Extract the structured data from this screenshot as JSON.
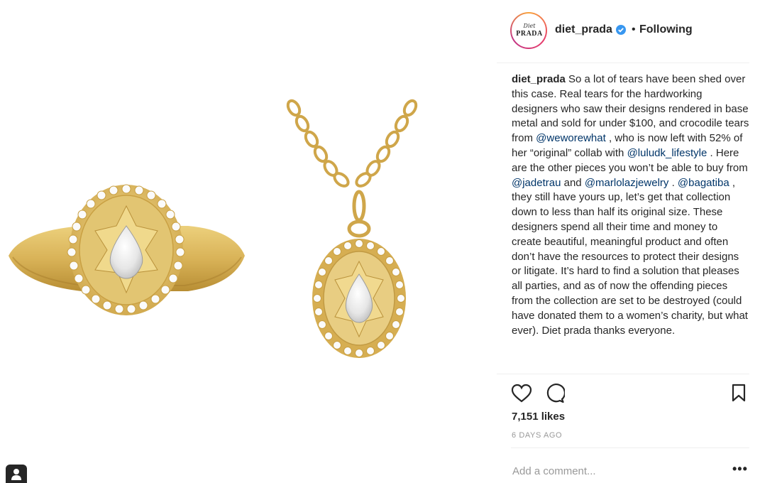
{
  "header": {
    "avatar_script": "Diet",
    "avatar_brand": "PRADA",
    "username": "diet_prada",
    "separator": "•",
    "follow_state": "Following"
  },
  "caption": {
    "username": "diet_prada",
    "t1": " So a lot of tears have been shed over this case.  Real tears for the hardworking designers who saw their designs rendered in base metal and sold for under $100, and crocodile tears from ",
    "m1": "@weworewhat",
    "t2": " , who is now left with 52% of her “original” collab with ",
    "m2": "@luludk_lifestyle",
    "t3": " . Here are the other pieces you won’t be able to buy from ",
    "m3": "@jadetrau",
    "t4": " and ",
    "m4": "@marlolazjewelry",
    "t5": " . ",
    "m5": "@bagatiba",
    "t6": " , they still have yours up, let’s get that collection down to less than half its original size. These designers spend all their time and money to create beautiful, meaningful product and often don’t have the resources to protect their designs or litigate. It’s hard to find a solution that pleases all parties, and as of now the offending pieces from the collection are set to be destroyed (could have donated them to a women’s charity, but what ever). Diet prada thanks everyone."
  },
  "stats": {
    "likes": "7,151 likes",
    "date": "6 DAYS AGO"
  },
  "comment": {
    "placeholder": "Add a comment...",
    "more": "•••"
  },
  "icons": {
    "like": "heart-icon",
    "comment": "comment-bubble-icon",
    "save": "bookmark-icon",
    "tags": "user-tag-icon",
    "verified": "verified-badge-icon"
  },
  "colors": {
    "mention": "#003569",
    "verified": "#3897f0",
    "muted": "#999999",
    "gold": "#d9b65a"
  }
}
